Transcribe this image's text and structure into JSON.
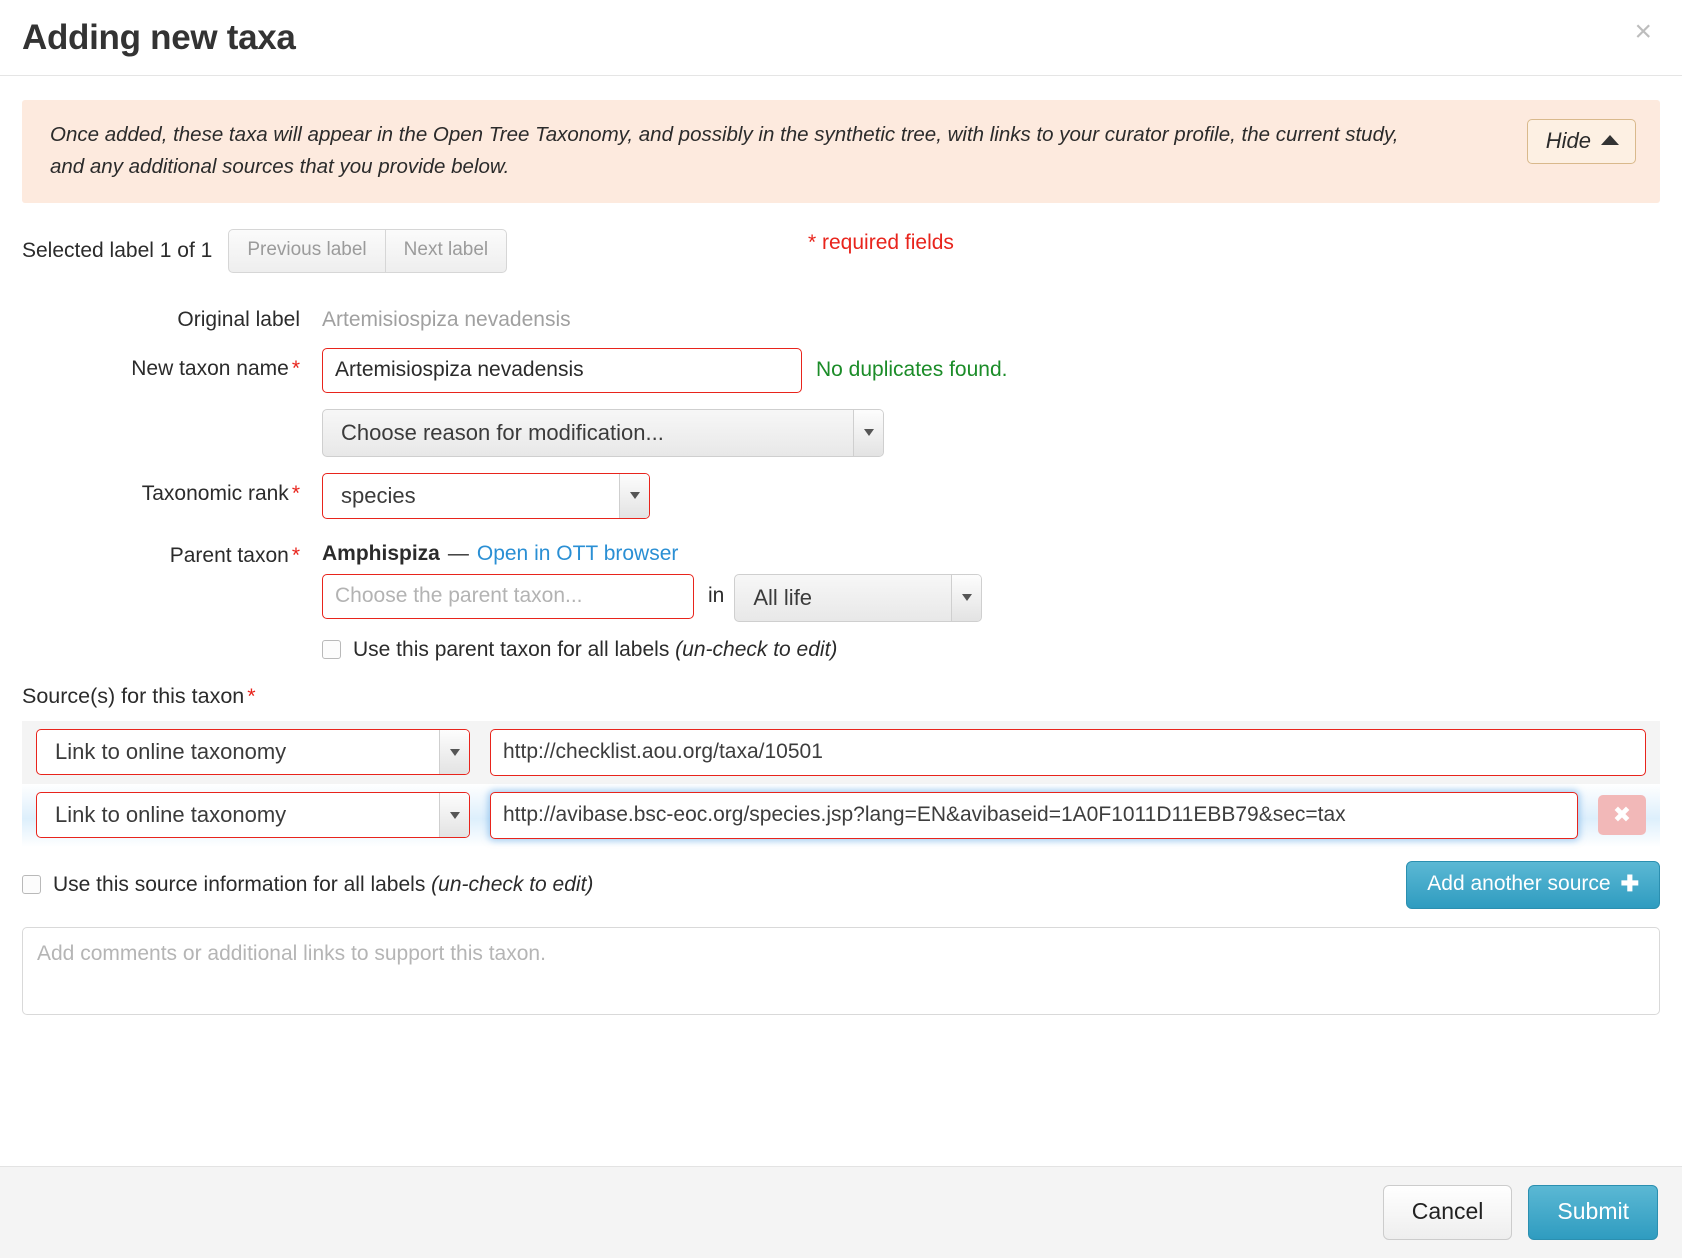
{
  "header": {
    "title": "Adding new taxa",
    "close_label": "×"
  },
  "notice": {
    "text": "Once added, these taxa will appear in the Open Tree Taxonomy, and possibly in the synthetic tree, with links to your curator profile, the current study, and any additional sources that you provide below.",
    "hide_label": "Hide"
  },
  "label_nav": {
    "selected_label_text": "Selected label 1 of 1",
    "previous_label": "Previous label",
    "next_label": "Next label",
    "required_fields_note": "* required fields"
  },
  "form": {
    "original_label_title": "Original label",
    "original_label_value": "Artemisiospiza nevadensis",
    "new_taxon_name_title": "New taxon name",
    "new_taxon_name_value": "Artemisiospiza nevadensis",
    "duplicates_message": "No duplicates found.",
    "reason_selected": "Choose reason for modification...",
    "taxonomic_rank_title": "Taxonomic rank",
    "taxonomic_rank_value": "species",
    "parent_taxon_title": "Parent taxon",
    "parent_taxon_name": "Amphispiza",
    "parent_taxon_dash": "—",
    "parent_taxon_link": "Open in OTT browser",
    "parent_input_placeholder": "Choose the parent taxon...",
    "parent_input_value": "",
    "in_word": "in",
    "scope_selected": "All life",
    "use_parent_for_all_prefix": "Use this parent taxon for all labels ",
    "use_parent_for_all_italic": "(un-check to edit)"
  },
  "sources": {
    "heading": "Source(s) for this taxon",
    "rows": [
      {
        "type": "Link to online taxonomy",
        "url": "http://checklist.aou.org/taxa/10501",
        "deletable": false
      },
      {
        "type": "Link to online taxonomy",
        "url": "http://avibase.bsc-eoc.org/species.jsp?lang=EN&avibaseid=1A0F1011D11EBB79&sec=tax",
        "deletable": true,
        "delete_label": "✖"
      }
    ],
    "use_source_for_all_prefix": "Use this source information for all labels ",
    "use_source_for_all_italic": "(un-check to edit)",
    "add_another_label": "Add another source",
    "add_another_icon": "✚",
    "comments_placeholder": "Add comments or additional links to support this taxon.",
    "comments_value": ""
  },
  "footer": {
    "cancel_label": "Cancel",
    "submit_label": "Submit"
  },
  "colors": {
    "required": "#e8241c",
    "success": "#1b8c28",
    "link": "#2a8fd4",
    "primary": "#2f9cc0",
    "notice_bg": "#fdeade"
  }
}
